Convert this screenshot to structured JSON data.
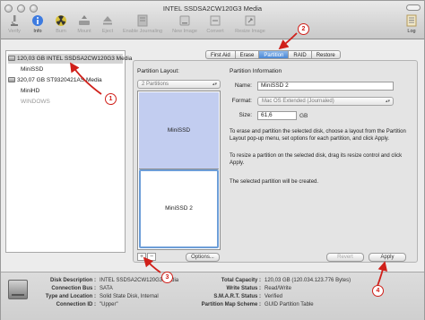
{
  "window": {
    "title": "INTEL SSDSA2CW120G3 Media"
  },
  "toolbar": {
    "verify": "Verify",
    "info": "Info",
    "burn": "Burn",
    "mount": "Mount",
    "eject": "Eject",
    "enable_journaling": "Enable Journaling",
    "new_image": "New Image",
    "convert": "Convert",
    "resize_image": "Resize Image",
    "log": "Log"
  },
  "sidebar": {
    "items": [
      {
        "label": "120,03 GB INTEL SSDSA2CW120G3 Media"
      },
      {
        "label": "MiniSSD"
      },
      {
        "label": "320,07 GB ST9320421AS Media"
      },
      {
        "label": "MiniHD"
      },
      {
        "label": "WINDOWS"
      }
    ]
  },
  "tabs": [
    {
      "label": "First Aid"
    },
    {
      "label": "Erase"
    },
    {
      "label": "Partition"
    },
    {
      "label": "RAID"
    },
    {
      "label": "Restore"
    }
  ],
  "partition_layout": {
    "heading": "Partition Layout:",
    "popup_value": "2 Partitions",
    "partitions": [
      {
        "name": "MiniSSD"
      },
      {
        "name": "MiniSSD 2"
      }
    ],
    "add_button": "+",
    "remove_button": "−",
    "options_button": "Options..."
  },
  "partition_info": {
    "heading": "Partition Information",
    "name_label": "Name:",
    "name_value": "MiniSSD 2",
    "format_label": "Format:",
    "format_value": "Mac OS Extended (Journaled)",
    "size_label": "Size:",
    "size_value": "61,6",
    "size_unit": "GB",
    "desc1": "To erase and partition the selected disk, choose a layout from the Partition Layout pop-up menu, set options for each partition, and click Apply.",
    "desc2": "To resize a partition on the selected disk, drag its resize control and click Apply.",
    "desc3": "The selected partition will be created.",
    "revert_button": "Revert",
    "apply_button": "Apply"
  },
  "footer": {
    "disk_description_label": "Disk Description :",
    "disk_description_value": "INTEL SSDSA2CW120G3 Media",
    "connection_bus_label": "Connection Bus :",
    "connection_bus_value": "SATA",
    "type_location_label": "Type and Location :",
    "type_location_value": "Solid State Disk, Internal",
    "connection_id_label": "Connection ID :",
    "connection_id_value": "\"Upper\"",
    "total_capacity_label": "Total Capacity :",
    "total_capacity_value": "120,03 GB (120.034.123.776 Bytes)",
    "write_status_label": "Write Status :",
    "write_status_value": "Read/Write",
    "smart_status_label": "S.M.A.R.T. Status :",
    "smart_status_value": "Verified",
    "partition_map_label": "Partition Map Scheme :",
    "partition_map_value": "GUID Partition Table"
  },
  "annotations": [
    "1",
    "2",
    "3",
    "4"
  ],
  "colors": {
    "accent": "#4a88d6",
    "selected_partition": "#c2cdf0",
    "annotation": "#d0201a"
  }
}
